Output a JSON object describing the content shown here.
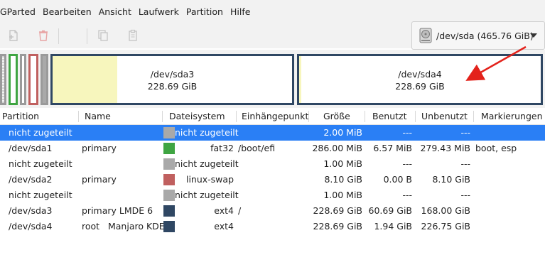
{
  "menubar": {
    "items": [
      "GParted",
      "Bearbeiten",
      "Ansicht",
      "Laufwerk",
      "Partition",
      "Hilfe"
    ]
  },
  "toolbar": {
    "buttons": [
      "new-partition",
      "delete-partition",
      "resize-move",
      "copy",
      "paste"
    ]
  },
  "device_selector": {
    "label": "/dev/sda (465.76 GiB)",
    "icon": "harddisk-icon"
  },
  "graphic": {
    "sda3": {
      "name": "/dev/sda3",
      "size": "228.69 GiB",
      "used_fraction": 0.27
    },
    "sda4": {
      "name": "/dev/sda4",
      "size": "228.69 GiB",
      "used_fraction": 0.01
    }
  },
  "colors": {
    "unallocated": "#a9a9a9",
    "fat32": "#3fa542",
    "linux_swap": "#c0605f",
    "ext4": "#2f4763",
    "selection": "#2a7ff5",
    "used": "#f7f6bd",
    "annotation_arrow": "#e3221b"
  },
  "table": {
    "headers": [
      "Partition",
      "Name",
      "Dateisystem",
      "Einhängepunkt",
      "Größe",
      "Benutzt",
      "Unbenutzt",
      "Markierungen"
    ],
    "rows": [
      {
        "partition": "nicht zugeteilt",
        "name": "",
        "fs": "nicht zugeteilt",
        "mount": "",
        "size": "2.00 MiB",
        "used": "---",
        "unused": "---",
        "flags": "",
        "color": "#a9a9a9",
        "selected": true
      },
      {
        "partition": "/dev/sda1",
        "name": "primary",
        "fs": "fat32",
        "mount": "/boot/efi",
        "size": "286.00 MiB",
        "used": "6.57 MiB",
        "unused": "279.43 MiB",
        "flags": "boot, esp",
        "color": "#3fa542",
        "selected": false
      },
      {
        "partition": "nicht zugeteilt",
        "name": "",
        "fs": "nicht zugeteilt",
        "mount": "",
        "size": "1.00 MiB",
        "used": "---",
        "unused": "---",
        "flags": "",
        "color": "#a9a9a9",
        "selected": false
      },
      {
        "partition": "/dev/sda2",
        "name": "primary",
        "fs": "linux-swap",
        "mount": "",
        "size": "8.10 GiB",
        "used": "0.00 B",
        "unused": "8.10 GiB",
        "flags": "",
        "color": "#c0605f",
        "selected": false
      },
      {
        "partition": "nicht zugeteilt",
        "name": "",
        "fs": "nicht zugeteilt",
        "mount": "",
        "size": "1.00 MiB",
        "used": "---",
        "unused": "---",
        "flags": "",
        "color": "#a9a9a9",
        "selected": false
      },
      {
        "partition": "/dev/sda3",
        "name": "primary LMDE 6",
        "fs": "ext4",
        "mount": "/",
        "size": "228.69 GiB",
        "used": "60.69 GiB",
        "unused": "168.00 GiB",
        "flags": "",
        "color": "#2f4763",
        "selected": false
      },
      {
        "partition": "/dev/sda4",
        "name": "root   Manjaro KDE",
        "fs": "ext4",
        "mount": "",
        "size": "228.69 GiB",
        "used": "1.94 GiB",
        "unused": "226.75 GiB",
        "flags": "",
        "color": "#2f4763",
        "selected": false
      }
    ]
  }
}
